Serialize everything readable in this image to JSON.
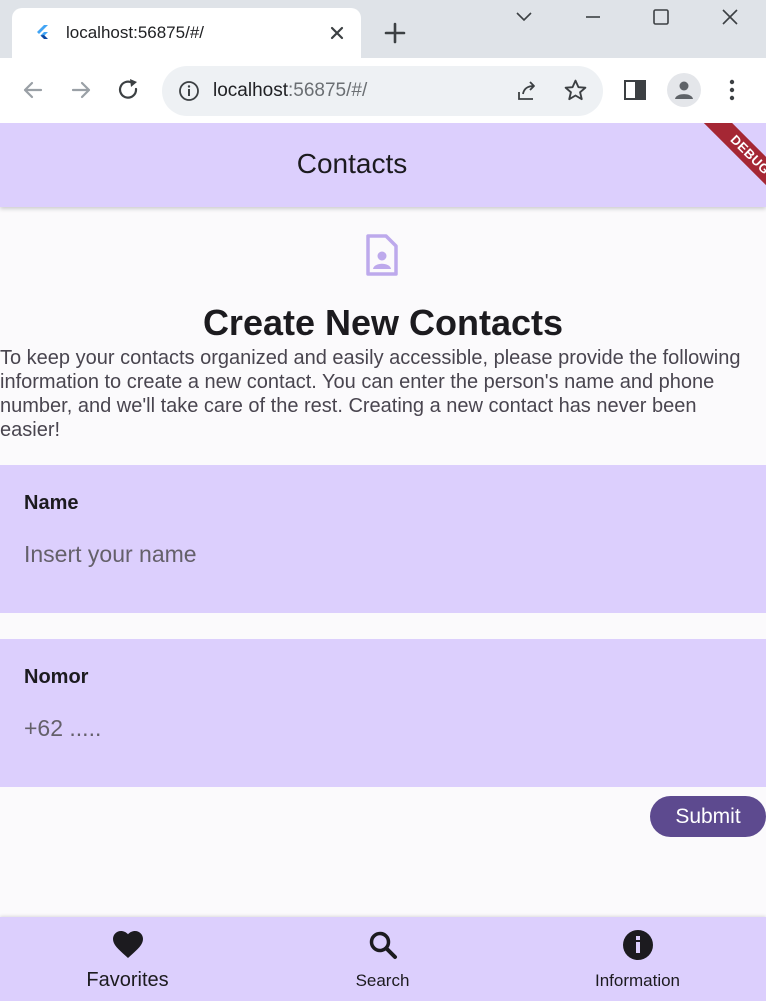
{
  "browser": {
    "tab_title": "localhost:56875/#/",
    "url_host": "localhost",
    "url_rest": ":56875/#/"
  },
  "app": {
    "title": "Contacts",
    "debug_banner": "DEBUG",
    "heading": "Create New Contacts",
    "description": "To keep your contacts organized and easily accessible, please provide the following information to create a new contact. You can enter the person's name and phone number, and we'll take care of the rest. Creating a new contact has never been easier!",
    "fields": [
      {
        "label": "Name",
        "placeholder": "Insert your name"
      },
      {
        "label": "Nomor",
        "placeholder": "+62 ....."
      }
    ],
    "submit_label": "Submit",
    "bottom_nav": [
      {
        "label": "Favorites",
        "icon": "heart-icon"
      },
      {
        "label": "Search",
        "icon": "search-icon"
      },
      {
        "label": "Information",
        "icon": "info-icon"
      }
    ]
  },
  "colors": {
    "primary_container": "#dccffd",
    "primary": "#5d4a8f",
    "background": "#fbfafc",
    "debug_ribbon": "#a52734"
  }
}
